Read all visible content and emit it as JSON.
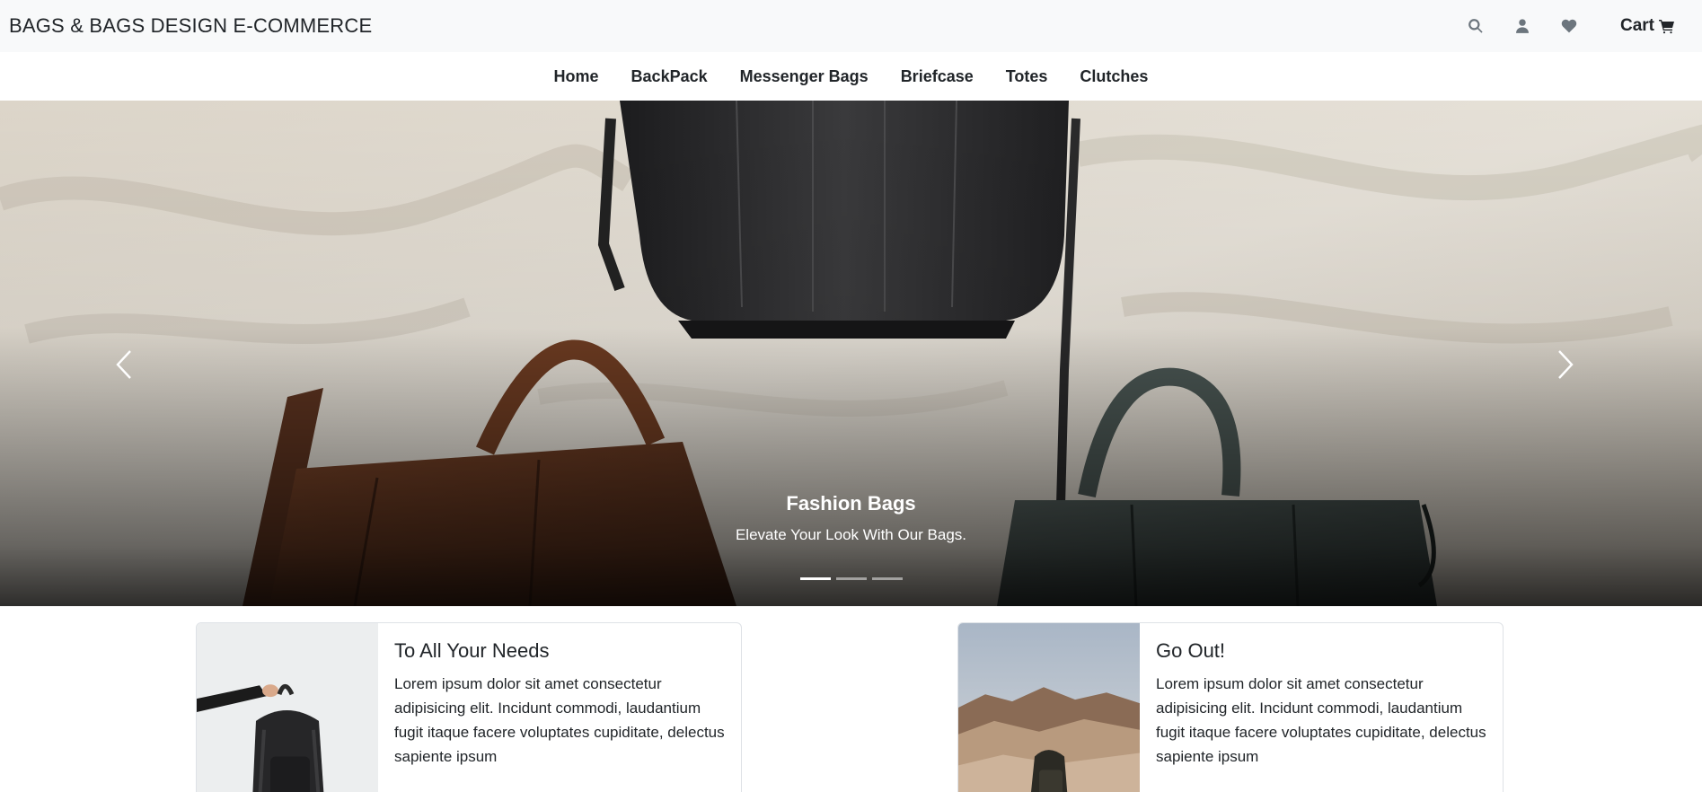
{
  "header": {
    "brand": "BAGS & BAGS DESIGN E-COMMERCE",
    "cart_label": "Cart",
    "icons": [
      "search-icon",
      "user-icon",
      "heart-icon",
      "cart-icon"
    ]
  },
  "nav": {
    "items": [
      "Home",
      "BackPack",
      "Messenger Bags",
      "Briefcase",
      "Totes",
      "Clutches"
    ]
  },
  "hero": {
    "caption_title": "Fashion Bags",
    "caption_subtitle": "Elevate Your Look With Our Bags.",
    "slide_count": 3,
    "active_slide": 1
  },
  "cards": [
    {
      "title": "To All Your Needs",
      "text": "Lorem ipsum dolor sit amet consectetur adipisicing elit. Incidunt commodi, laudantium fugit itaque facere voluptates cupiditate, delectus sapiente ipsum"
    },
    {
      "title": "Go Out!",
      "text": "Lorem ipsum dolor sit amet consectetur adipisicing elit. Incidunt commodi, laudantium fugit itaque facere voluptates cupiditate, delectus sapiente ipsum"
    }
  ]
}
